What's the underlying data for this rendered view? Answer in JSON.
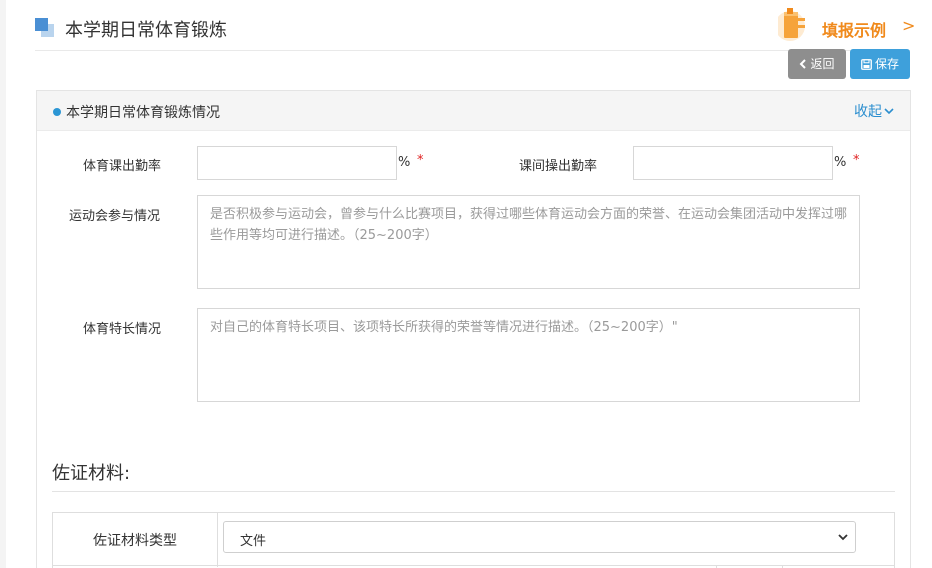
{
  "header": {
    "title": "本学期日常体育锻炼",
    "example_link": "填报示例",
    "example_arrow": ">",
    "back_label": "返回",
    "save_label": "保存"
  },
  "panel": {
    "title": "本学期日常体育锻炼情况",
    "collapse_label": "收起",
    "fields": {
      "pe_attendance_label": "体育课出勤率",
      "pe_attendance_value": "",
      "pe_attendance_unit": "%",
      "exercise_attendance_label": "课间操出勤率",
      "exercise_attendance_value": "",
      "exercise_attendance_unit": "%",
      "required_mark": "*",
      "sports_meet_label": "运动会参与情况",
      "sports_meet_placeholder": "是否积极参与运动会，曾参与什么比赛项目，获得过哪些体育运动会方面的荣誉、在运动会集团活动中发挥过哪些作用等均可进行描述。（25~200字）",
      "specialty_label": "体育特长情况",
      "specialty_placeholder": "对自己的体育特长项目、该项特长所获得的荣誉等情况进行描述。（25~200字）\""
    },
    "evidence": {
      "section_title": "佐证材料:",
      "type_label": "佐证材料类型",
      "type_selected": "文件"
    }
  },
  "colors": {
    "accent": "#3ea0db",
    "link": "#2b8ecf",
    "example": "#f08a1c",
    "required": "#e02020",
    "back_button": "#8e8e8e"
  },
  "icons": {
    "title": "title-squares-icon",
    "example": "book-stack-icon",
    "back": "chevron-left-icon",
    "save": "floppy-disk-icon",
    "collapse": "chevron-down-icon",
    "select": "chevron-down-icon"
  }
}
